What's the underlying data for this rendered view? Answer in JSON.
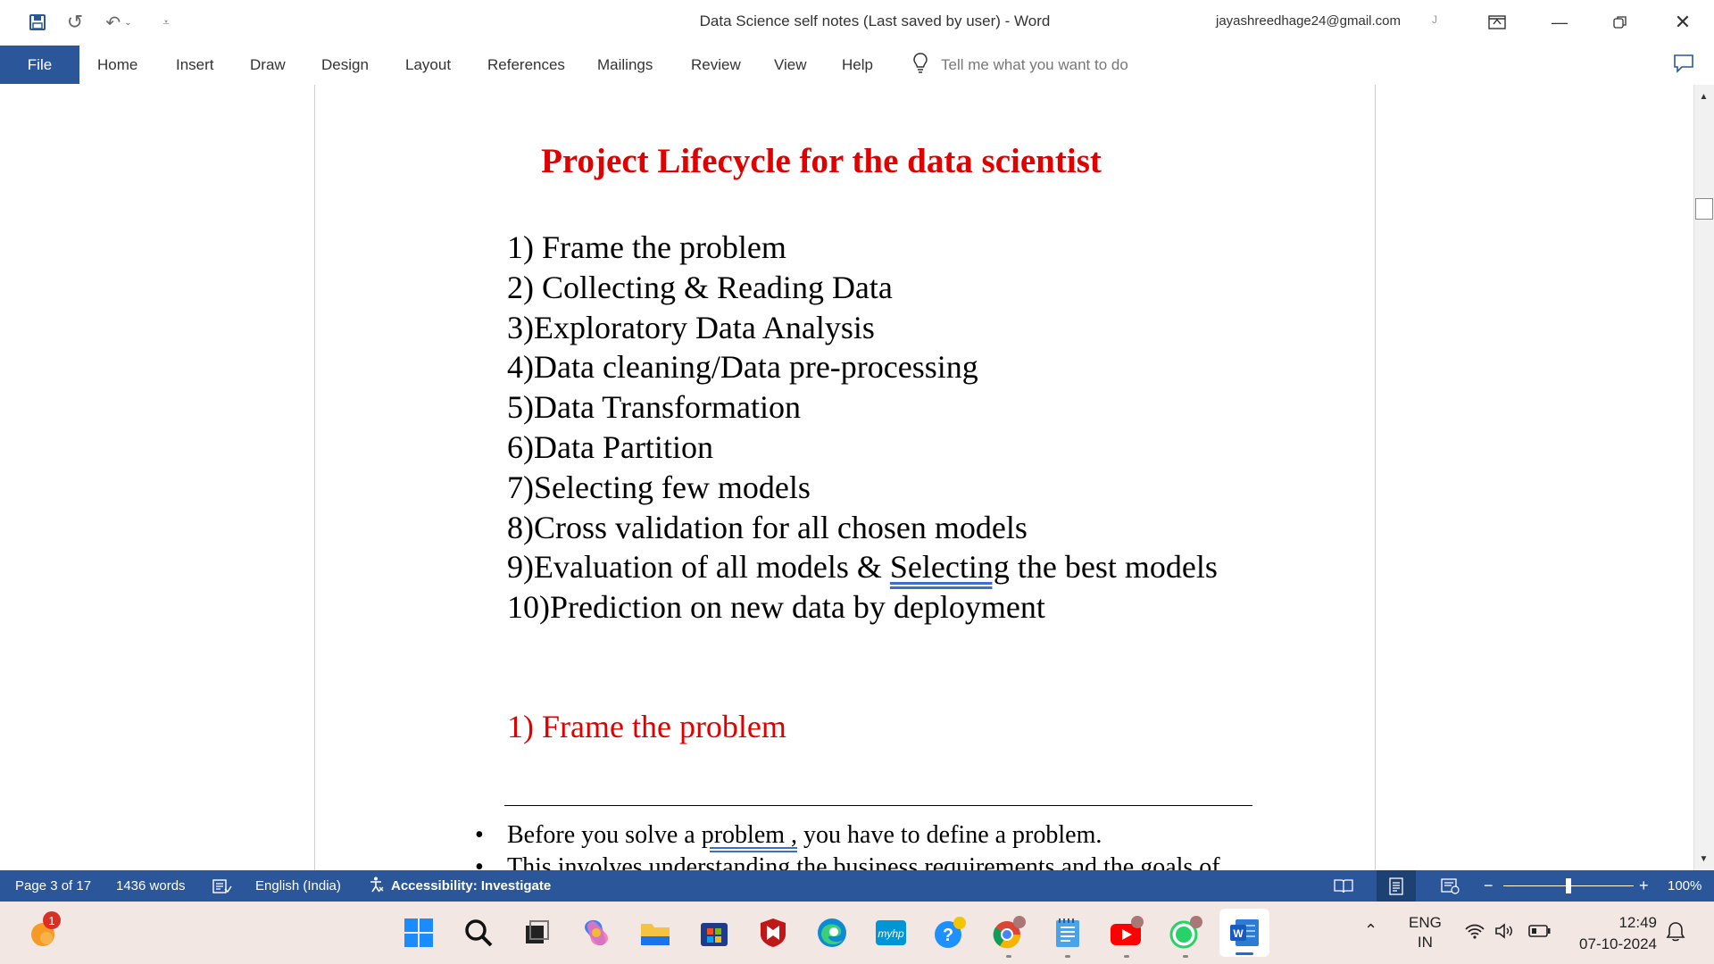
{
  "titlebar": {
    "document_title": "Data Science self notes (Last saved by user)  -  Word",
    "user_email": "jayashreedhage24@gmail.com",
    "user_initial": "J"
  },
  "ribbon": {
    "file_tab": "File",
    "tabs": [
      "Home",
      "Insert",
      "Draw",
      "Design",
      "Layout",
      "References",
      "Mailings",
      "Review",
      "View",
      "Help"
    ],
    "tell_me_placeholder": "Tell me what you want to do"
  },
  "document": {
    "heading": "Project Lifecycle for the data scientist",
    "steps": [
      "1) Frame the problem",
      "2) Collecting & Reading Data",
      "3)Exploratory Data Analysis",
      "4)Data cleaning/Data pre-processing",
      "5)Data Transformation",
      "6)Data Partition",
      "7)Selecting few models",
      "8)Cross validation for all chosen models",
      "10)Prediction on new data by deployment"
    ],
    "step9": {
      "before": "9)Evaluation of all models & ",
      "flagged": "Selecting",
      "after": " the best models"
    },
    "section_heading": "1) Frame the problem",
    "bullet1": {
      "before": "Before you solve a ",
      "flagged": "problem ,",
      "after": " you have to define a problem."
    },
    "bullet2": "This involves understanding the business requirements and the goals of"
  },
  "statusbar": {
    "page": "Page 3 of 17",
    "words": "1436 words",
    "language": "English (India)",
    "accessibility": "Accessibility: Investigate",
    "zoom": "100%",
    "zoom_level": 1.0
  },
  "taskbar": {
    "weather_badge": "1",
    "lang_line1": "ENG",
    "lang_line2": "IN",
    "time": "12:49",
    "date": "07-10-2024"
  },
  "colors": {
    "accent": "#2b579a",
    "heading_red": "#e00000",
    "taskbar_bg": "#f2e7e3"
  }
}
